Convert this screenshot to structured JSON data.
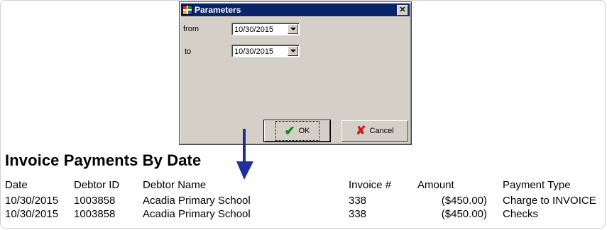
{
  "dialog": {
    "title": "Parameters",
    "close_label": "✕",
    "from_label": "from",
    "to_label": "to",
    "from_value": "10/30/2015",
    "to_value": "10/30/2015",
    "ok_label": "OK",
    "cancel_label": "Cancel"
  },
  "report": {
    "title": "Invoice Payments By Date",
    "columns": [
      "Date",
      "Debtor ID",
      "Debtor Name",
      "Invoice #",
      "Amount",
      "Payment Type"
    ],
    "rows": [
      [
        "10/30/2015",
        "1003858",
        "Acadia Primary School",
        "338",
        "($450.00)",
        "Charge to INVOICE"
      ],
      [
        "10/30/2015",
        "1003858",
        "Acadia Primary School",
        "338",
        "($450.00)",
        "Checks"
      ]
    ]
  },
  "colors": {
    "titlebar": "#0a246a",
    "dialog_face": "#d4d0c8",
    "arrow": "#1f2f9a",
    "ok_check": "#1a8a1a",
    "cancel_x": "#d21c1c"
  },
  "icons": [
    "app-icon",
    "close-icon",
    "dropdown-arrow-icon",
    "check-icon",
    "cancel-x-icon",
    "down-arrow-annotation"
  ]
}
